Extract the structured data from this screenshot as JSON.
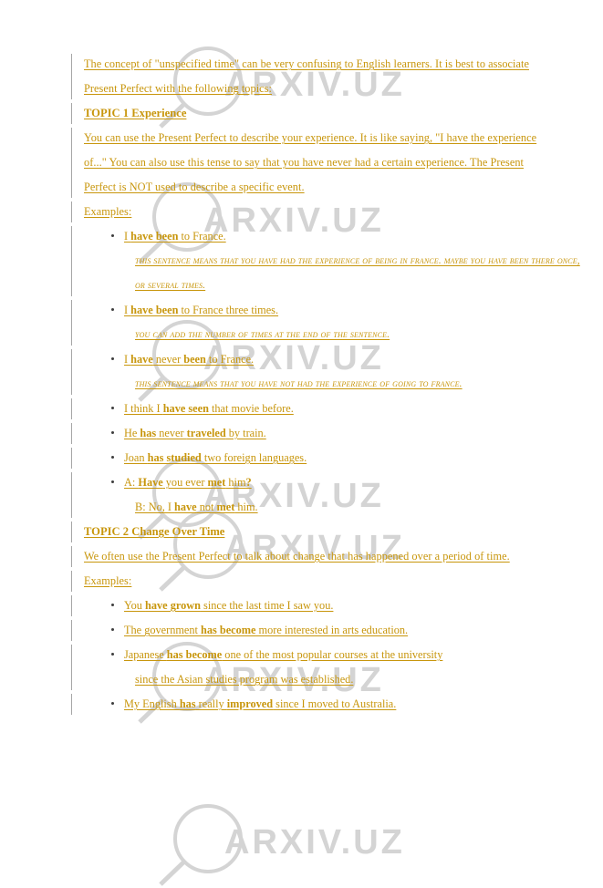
{
  "document": {
    "watermark": {
      "text": "ARXIV.UZ",
      "icon": "magnifier-icon",
      "color": "#d4d4d4"
    },
    "text_color": "#c8960c",
    "intro": {
      "lines": [
        "The concept of \"unspecified time\" can be very confusing to English learners. It is best to associate Present Perfect with the following topics:"
      ]
    },
    "topic1": {
      "heading": "TOPIC 1 Experience",
      "body": "You can use the Present Perfect to describe your experience. It is like saying, \"I have the experience of...\" You can also use this tense to say that you have never had a certain experience. The Present Perfect is NOT used to describe a specific event.",
      "examples_label": "Examples:",
      "examples": [
        {
          "pre": "I ",
          "bold1": "have been",
          "mid": " to France.",
          "note": "This sentence means that you have had the experience of being in France. Maybe you have been there once, or several times."
        },
        {
          "pre": "I ",
          "bold1": "have been",
          "mid": " to France three times.",
          "note": "You can add the number of times at the end of the sentence."
        },
        {
          "pre": "I ",
          "bold1": "have",
          "mid": " never ",
          "bold2": "been",
          "post": " to France.",
          "note": "This sentence means that you have not had the experience of going to France."
        },
        {
          "pre": "I think I ",
          "bold1": "have seen",
          "mid": " that movie before.",
          "note": ""
        },
        {
          "pre": "He ",
          "bold1": "has",
          "mid": " never ",
          "bold2": "traveled",
          "post": " by train.",
          "note": ""
        },
        {
          "pre": "Joan ",
          "bold1": "has studied",
          "mid": " two foreign languages.",
          "note": ""
        },
        {
          "pre": "A: ",
          "bold1": "Have",
          "mid": " you ever ",
          "bold2": "met",
          "post": " him",
          "bold3": "?",
          "continuation": {
            "pre": "B: No, I ",
            "bold1": "have",
            "mid": " not ",
            "bold2": "met",
            "post": " him."
          }
        }
      ]
    },
    "topic2": {
      "heading": "TOPIC 2 Change Over Time",
      "body": "We often use the Present Perfect to talk about change that has happened over a period of time.",
      "examples_label": "Examples:",
      "examples": [
        {
          "pre": "You ",
          "bold1": "have grown",
          "mid": " since the last time I saw you."
        },
        {
          "pre": "The government ",
          "bold1": "has become",
          "mid": " more interested in arts education."
        },
        {
          "pre": "Japanese ",
          "bold1": "has become",
          "mid": " one of the most popular courses at the university",
          "wrap": "since the Asian studies program was established."
        },
        {
          "pre": "My English ",
          "bold1": "has",
          "mid": " really ",
          "bold2": "improved",
          "post": " since I moved to Australia."
        }
      ]
    }
  }
}
